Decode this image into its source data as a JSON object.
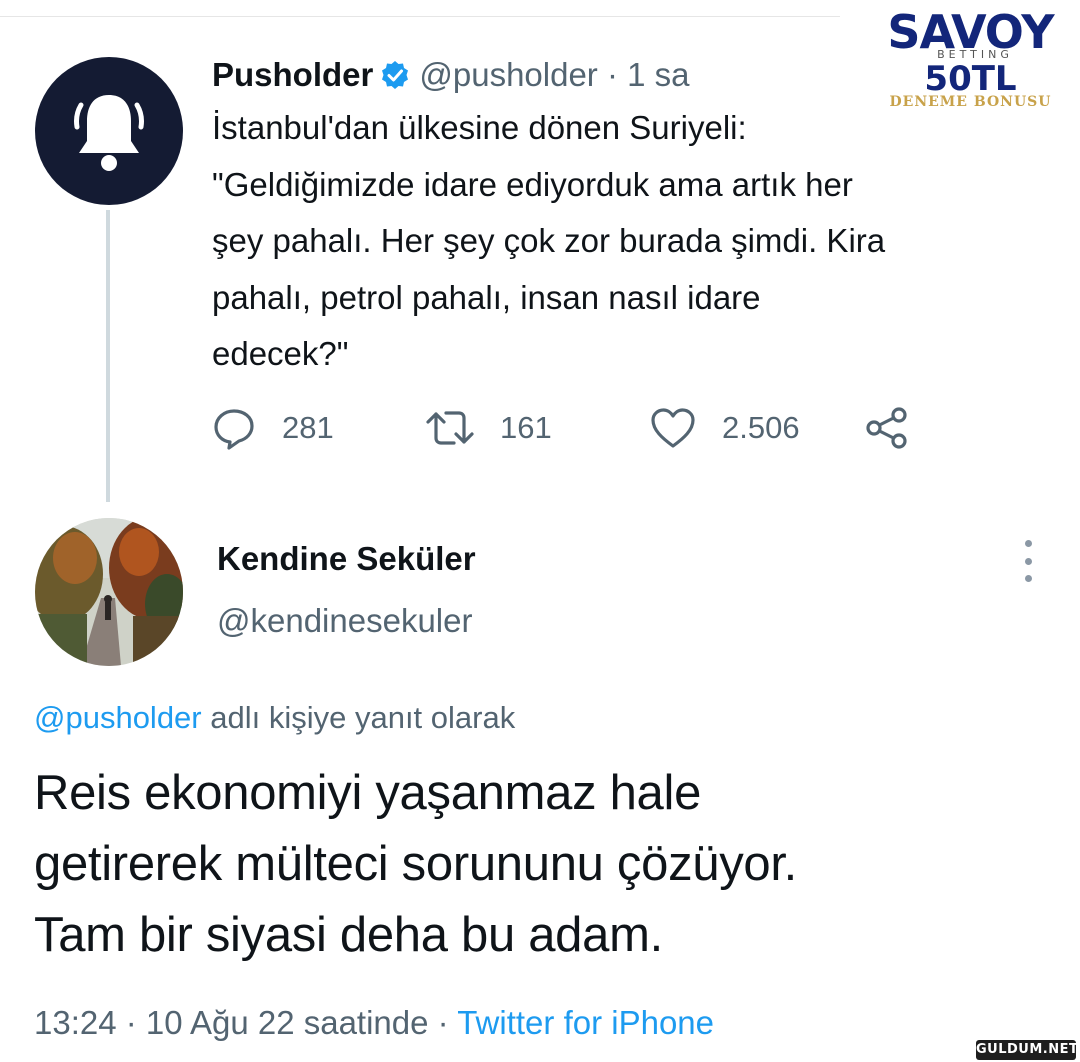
{
  "ad": {
    "brand": "SAVOY",
    "sub": "BETTING",
    "amount": "50TL",
    "bonus": "DENEME BONUSU",
    "colors": {
      "brand": "#13267a",
      "bonus": "#c8a24a"
    }
  },
  "tweet": {
    "author": {
      "name": "Pusholder",
      "handle": "@pusholder",
      "time": "· 1 sa",
      "avatar_icon": "bell-icon",
      "verified_icon": "verified-badge-icon"
    },
    "text": "İstanbul'dan ülkesine dönen Suriyeli:\n\"Geldiğimizde idare ediyorduk ama artık her\nşey pahalı. Her şey çok zor burada şimdi. Kira\npahalı, petrol pahalı, insan nasıl idare\nedecek?\"",
    "actions": {
      "replies": "281",
      "retweets": "161",
      "likes": "2.506"
    }
  },
  "reply": {
    "author": {
      "name": "Kendine Seküler",
      "handle": "@kendinesekuler"
    },
    "reply_to": {
      "mention": "@pusholder",
      "suffix": " adlı kişiye yanıt olarak"
    },
    "text": "Reis ekonomiyi yaşanmaz hale\ngetirerek mülteci sorununu çözüyor.\nTam bir siyasi deha bu adam.",
    "meta": {
      "datetime": "13:24 · 10 Ağu 22 saatinde · ",
      "source": "Twitter for iPhone"
    }
  },
  "watermark": "GULDUM.NET",
  "colors": {
    "link": "#1d9bf0",
    "secondary_text": "#536471",
    "primary_text": "#0f1419",
    "avatar_bg": "#141b33"
  }
}
